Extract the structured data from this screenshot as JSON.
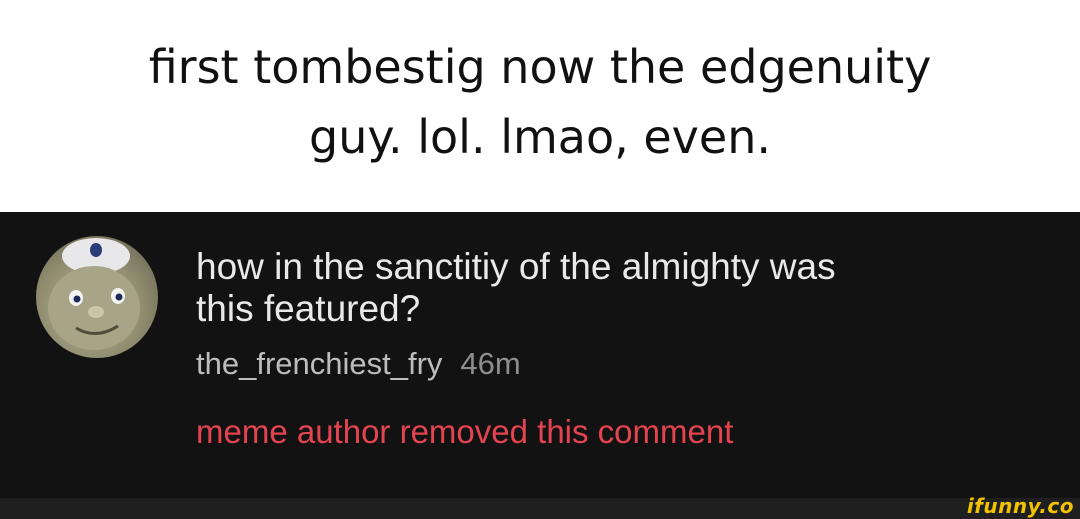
{
  "caption": {
    "line1": "first tombestig now the edgenuity",
    "line2": "guy. lol. lmao, even."
  },
  "comment": {
    "avatar_icon": "cartoon-character-avatar",
    "text_line1": "how in the sanctitiy of the almighty was",
    "text_line2": "this featured?",
    "username": "the_frenchiest_fry",
    "timestamp": "46m",
    "removed_notice": "meme author removed this comment"
  },
  "watermark": {
    "text": "ifunny.co",
    "color": "#f2c200"
  },
  "colors": {
    "panel_background": "#121212",
    "comment_text": "#e9e9e9",
    "username": "#bdbdbd",
    "timestamp": "#8e8e8e",
    "removed_notice": "#e3444f"
  }
}
